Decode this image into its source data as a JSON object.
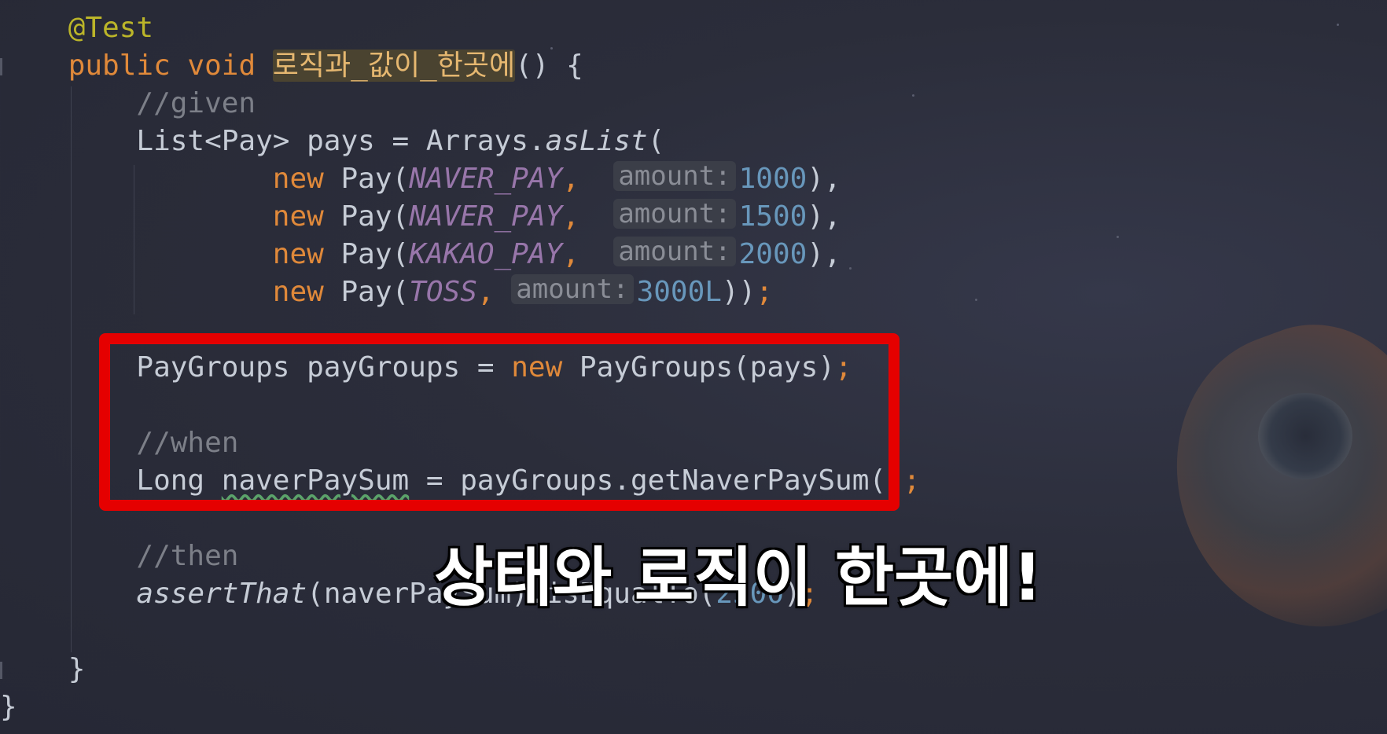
{
  "code": {
    "annotation": "@Test",
    "signature_kw": "public void ",
    "method_name": "로직과_값이_한곳에",
    "signature_rest": "() {",
    "comment_given": "//given",
    "list_decl_a": "List<Pay> pays = Arrays.",
    "list_decl_method": "asList",
    "list_decl_paren": "(",
    "new_kw": "new",
    "pay_call": " Pay(",
    "hint_label": "amount:",
    "pays": [
      {
        "const": "NAVER_PAY",
        "amount": "1000",
        "tail": "),"
      },
      {
        "const": "NAVER_PAY",
        "amount": "1500",
        "tail": "),"
      },
      {
        "const": "KAKAO_PAY",
        "amount": "2000",
        "tail": "),"
      },
      {
        "const": "TOSS",
        "amount": "3000L",
        "tail": "))"
      }
    ],
    "comma": ",",
    "semicolon": ";",
    "paygroups_a": "PayGroups payGroups = ",
    "paygroups_b": " PayGroups(pays)",
    "comment_when": "//when",
    "long_a": "Long ",
    "long_var": "naverPaySum",
    "long_b": " = payGroups.getNaverPaySum()",
    "comment_then": "//then",
    "assert_method": "assertThat",
    "assert_a": "(naverPaySum).isEqualTo(",
    "assert_num": "2500",
    "assert_b": ")",
    "close_inner": "}",
    "close_outer": "}"
  },
  "caption": "상태와 로직이 한곳에!",
  "colors": {
    "background": "#2b2d3a",
    "keyword": "#e0893a",
    "annotation": "#bbb529",
    "comment": "#7c7f88",
    "constant": "#9876aa",
    "number": "#6897bb",
    "highlight_box": "#e50000",
    "caption_text": "#ffffff"
  }
}
